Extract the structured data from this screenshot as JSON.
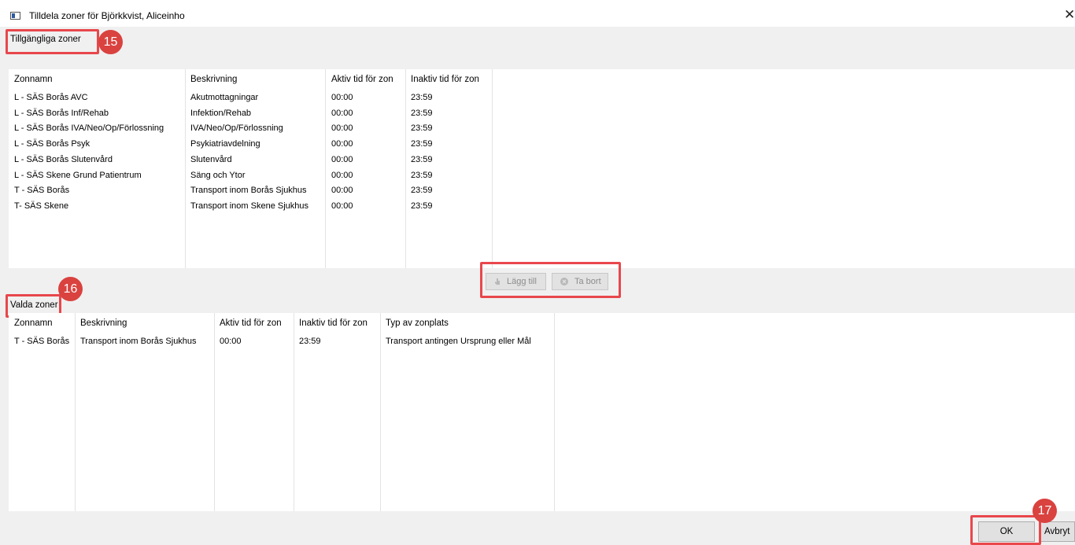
{
  "window": {
    "title": "Tilldela zoner för Björkkvist, Aliceinho",
    "close_glyph": "✕"
  },
  "available": {
    "label": "Tillgängliga zoner",
    "badge": "15",
    "headers": [
      "Zonnamn",
      "Beskrivning",
      "Aktiv tid för zon",
      "Inaktiv tid för zon"
    ],
    "rows": [
      [
        "L - SÄS Borås AVC",
        "Akutmottagningar",
        "00:00",
        "23:59"
      ],
      [
        "L - SÄS Borås Inf/Rehab",
        "Infektion/Rehab",
        "00:00",
        "23:59"
      ],
      [
        "L - SÄS Borås IVA/Neo/Op/Förlossning",
        "IVA/Neo/Op/Förlossning",
        "00:00",
        "23:59"
      ],
      [
        "L - SÄS Borås Psyk",
        "Psykiatriavdelning",
        "00:00",
        "23:59"
      ],
      [
        "L - SÄS Borås Slutenvård",
        "Slutenvård",
        "00:00",
        "23:59"
      ],
      [
        "L - SÄS Skene Grund Patientrum",
        "Säng och Ytor",
        "00:00",
        "23:59"
      ],
      [
        "T - SÄS Borås",
        "Transport inom Borås Sjukhus",
        "00:00",
        "23:59"
      ],
      [
        "T- SÄS Skene",
        "Transport inom Skene Sjukhus",
        "00:00",
        "23:59"
      ]
    ]
  },
  "actions": {
    "add_label": "Lägg till",
    "remove_label": "Ta bort",
    "add_icon": "add-hand-icon",
    "remove_icon": "remove-circle-icon"
  },
  "selected": {
    "label": "Valda zoner",
    "badge": "16",
    "headers": [
      "Zonnamn",
      "Beskrivning",
      "Aktiv tid för zon",
      "Inaktiv tid för zon",
      "Typ av zonplats"
    ],
    "rows": [
      [
        "T - SÄS Borås",
        "Transport inom Borås Sjukhus",
        "00:00",
        "23:59",
        "Transport antingen Ursprung eller Mål"
      ]
    ]
  },
  "footer": {
    "ok_label": "OK",
    "cancel_label": "Avbryt",
    "badge": "17"
  },
  "colors": {
    "highlight": "#e8474c",
    "badge": "#d9423f"
  }
}
